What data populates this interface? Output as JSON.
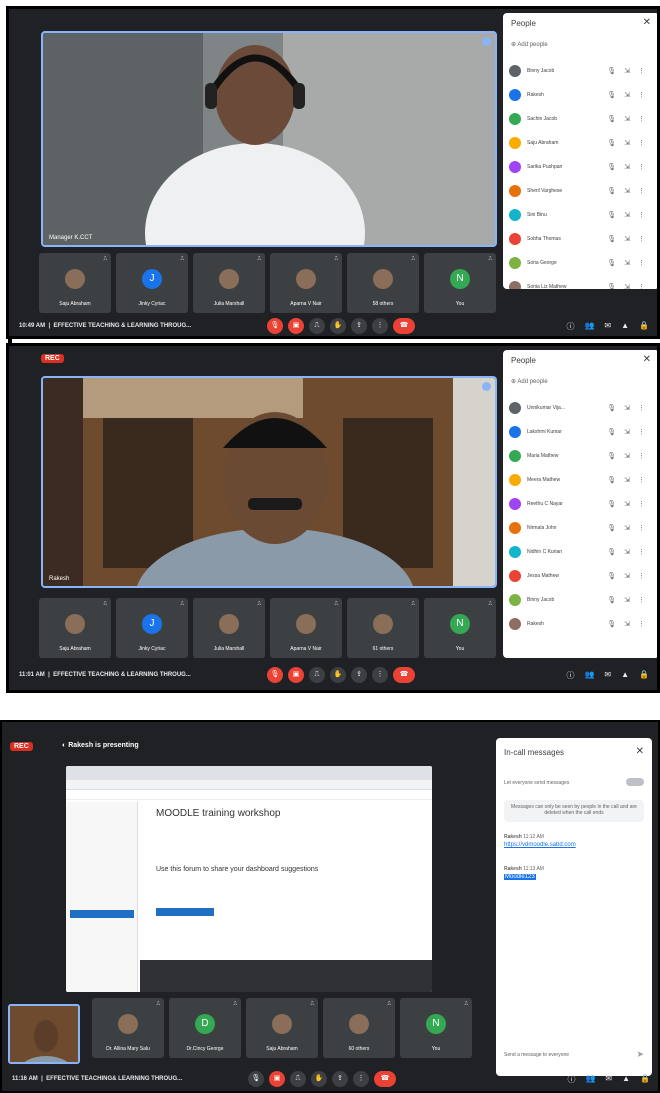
{
  "rec_label": "REC",
  "screen1": {
    "main_speaker": "Manager K.CCT",
    "people_title": "People",
    "add_people": "Add people",
    "people": [
      "Binny Jacob",
      "Rakesh",
      "Sachin Jacob",
      "Saju Abraham",
      "Sarika Pushpan",
      "Sheril Varghese",
      "Sini Binu",
      "Sobha Thomas",
      "Sona George",
      "Sonia Liz Mathew"
    ],
    "tiles": [
      {
        "name": "Saju Abraham",
        "initial": ""
      },
      {
        "name": "Jinky Cyriac",
        "initial": "J"
      },
      {
        "name": "Julia Marshall",
        "initial": ""
      },
      {
        "name": "Aparna V Nair",
        "initial": ""
      },
      {
        "name": "58 others",
        "initial": ""
      },
      {
        "name": "You",
        "initial": "N"
      }
    ],
    "time": "10:49 AM",
    "meeting": "EFFECTIVE TEACHING & LEARNING THROUG..."
  },
  "screen2": {
    "main_speaker": "Rakesh",
    "people_title": "People",
    "add_people": "Add people",
    "people": [
      "Unnikumar Vija...",
      "Lakshmi Kumar",
      "Maria Mathew",
      "Meera Mathew",
      "Reethu C Nayar",
      "Nirmala John",
      "Nidhin C Kurian",
      "Jessa Mathew",
      "Binny Jacob",
      "Rakesh"
    ],
    "tiles": [
      {
        "name": "Saju Abraham",
        "initial": ""
      },
      {
        "name": "Jinky Cyriac",
        "initial": "J"
      },
      {
        "name": "Julia Marshall",
        "initial": ""
      },
      {
        "name": "Aparna V Nair",
        "initial": ""
      },
      {
        "name": "61 others",
        "initial": ""
      },
      {
        "name": "You",
        "initial": "N"
      }
    ],
    "time": "11:01 AM",
    "meeting": "EFFECTIVE TEACHING & LEARNING THROUG..."
  },
  "screen3": {
    "presenting": "Rakesh is presenting",
    "page_heading": "MOODLE training workshop",
    "forum_text": "Use this forum to share your dashboard suggestions",
    "chat_title": "In-call messages",
    "chat_toggle": "Let everyone send messages",
    "chat_notice": "Messages can only be seen by people in the call and are deleted when the call ends",
    "msg1_sender": "Rakesh",
    "msg1_time": "11:12 AM",
    "msg1_link": "https://vdmoodle.sabd.com",
    "msg2_sender": "Rakesh",
    "msg2_time": "11:13 AM",
    "msg2_text": "Moodle123",
    "chat_placeholder": "Send a message to everyone",
    "tiles": [
      {
        "name": "Dr. Allina Mary Salu",
        "initial": ""
      },
      {
        "name": "Dr.Cincy George",
        "initial": "D"
      },
      {
        "name": "Saju Abraham",
        "initial": ""
      },
      {
        "name": "60 others",
        "initial": ""
      },
      {
        "name": "You",
        "initial": "N"
      }
    ],
    "time": "11:16 AM",
    "meeting": "EFFECTIVE TEACHING& LEARNING THROUG..."
  },
  "colors": {
    "accent": "#8ab4f8",
    "danger": "#ea4335",
    "bg": "#202124",
    "tile": "#3c4043"
  }
}
